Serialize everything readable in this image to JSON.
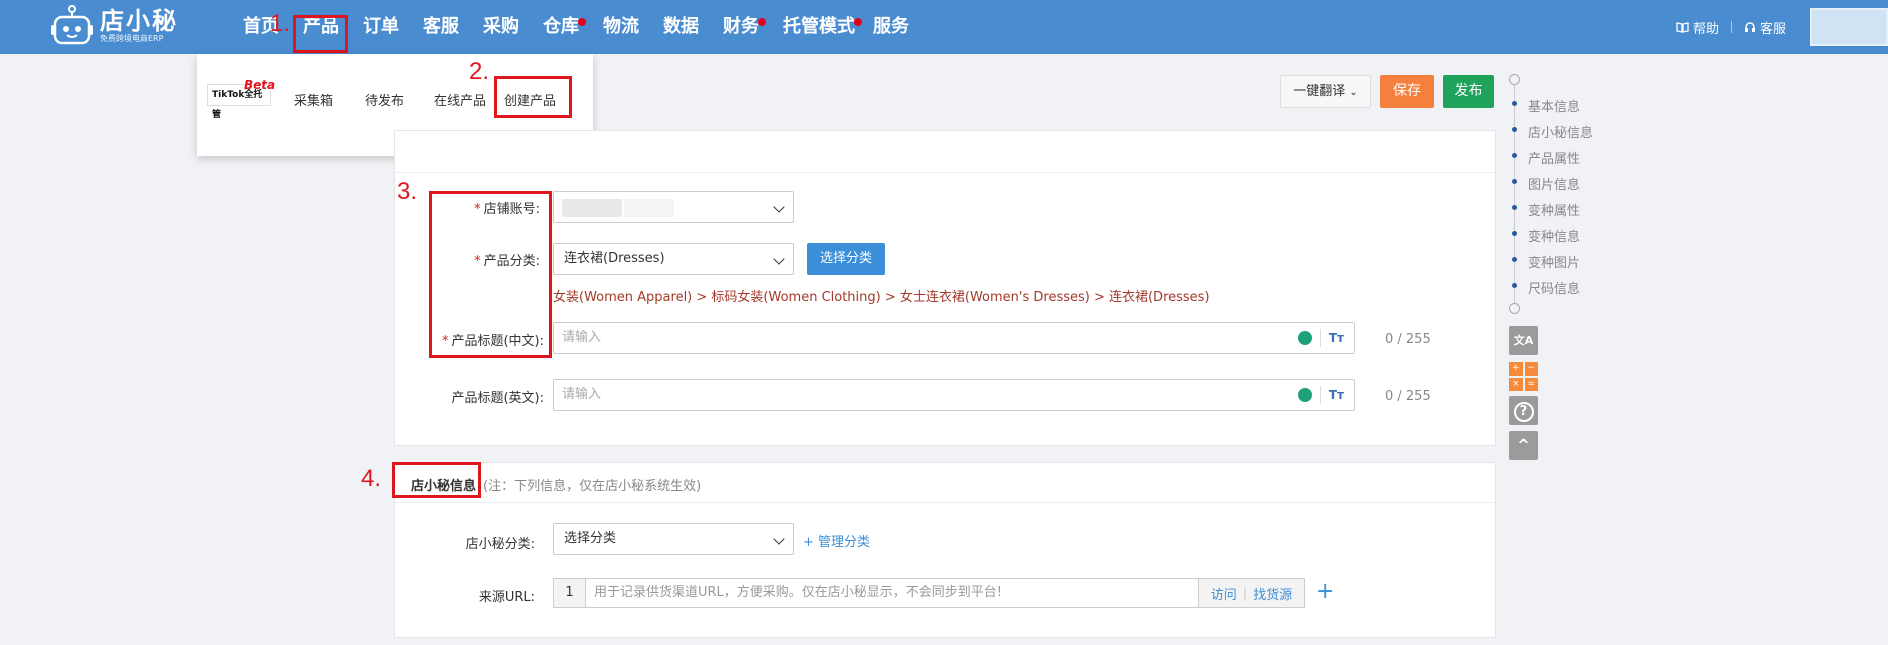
{
  "logo": {
    "title": "店小秘",
    "subtitle": "免费跨境电商ERP"
  },
  "nav": [
    {
      "label": "首页",
      "dot": false
    },
    {
      "label": "产品",
      "dot": false
    },
    {
      "label": "订单",
      "dot": false
    },
    {
      "label": "客服",
      "dot": false
    },
    {
      "label": "采购",
      "dot": false
    },
    {
      "label": "仓库",
      "dot": true
    },
    {
      "label": "物流",
      "dot": false
    },
    {
      "label": "数据",
      "dot": false
    },
    {
      "label": "财务",
      "dot": true
    },
    {
      "label": "托管模式",
      "dot": true
    },
    {
      "label": "服务",
      "dot": false
    }
  ],
  "top_right": {
    "help": "帮助",
    "service": "客服"
  },
  "annotations": {
    "step1": "1.",
    "step2": "2.",
    "step3": "3.",
    "step4": "4."
  },
  "dropdown": {
    "tiktok": "TikTok全托管",
    "beta": "Beta",
    "items": [
      "采集箱",
      "待发布",
      "在线产品",
      "创建产品"
    ]
  },
  "toolbar": {
    "translate": "一键翻译",
    "save": "保存",
    "publish": "发布"
  },
  "form": {
    "shop_label": "店铺账号:",
    "category_label": "产品分类:",
    "category_value": "连衣裙(Dresses)",
    "select_category_btn": "选择分类",
    "category_path": "女装(Women Apparel)  > 标码女装(Women Clothing)  > 女士连衣裙(Women's Dresses)  > 连衣裙(Dresses)",
    "title_cn_label": "产品标题(中文):",
    "title_cn_placeholder": "请输入",
    "title_cn_counter": "0 / 255",
    "title_en_label": "产品标题(英文):",
    "title_en_placeholder": "请输入",
    "title_en_counter": "0 / 255",
    "required_mark": "*",
    "tt_icon": "Tт"
  },
  "dxm_section": {
    "title": "店小秘信息",
    "note": "(注：下列信息，仅在店小秘系统生效)",
    "category_label": "店小秘分类:",
    "category_placeholder": "选择分类",
    "manage_link": "+ 管理分类",
    "url_label": "来源URL:",
    "url_index": "1",
    "url_placeholder": "用于记录供货渠道URL，方便采购。仅在店小秘显示，不会同步到平台!",
    "visit": "访问",
    "find_source": "找货源",
    "add": "+"
  },
  "sidenav": [
    "基本信息",
    "店小秘信息",
    "产品属性",
    "图片信息",
    "变种属性",
    "变种信息",
    "变种图片",
    "尺码信息"
  ],
  "tools": {
    "translate_icon": "文A",
    "calc": [
      "+",
      "−",
      "×",
      "="
    ],
    "help_icon": "?",
    "top_icon": "^"
  },
  "colors": {
    "nav_bg": "#4a8cd0",
    "save": "#f57f3d",
    "publish": "#1fa25a",
    "highlight": "#e0161e",
    "link": "#3b8ed8"
  }
}
